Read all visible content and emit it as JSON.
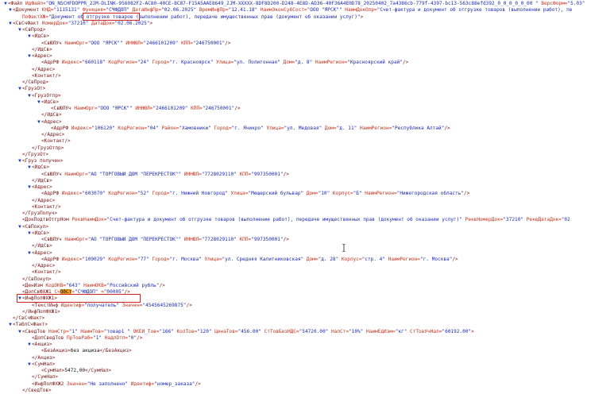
{
  "colors": {
    "tag": "#7a1414",
    "attr_name": "#c8321e",
    "attr_value": "#1e2ab4",
    "text": "#111111",
    "toggle": "#1a3fb5",
    "search_highlight": "#f5a81c",
    "annotation_box": "#d32222"
  },
  "toggles": {
    "expanded": "▼",
    "collapsed": "▶"
  },
  "annotations": {
    "box1_label": "function-attribute-highlight",
    "box2_label": "dopsvfkhzh1-line-highlight"
  },
  "xml_lines": [
    {
      "indent": 0,
      "toggle": "expanded",
      "segments": [
        [
          "tg",
          "<Файл "
        ],
        [
          "an",
          "ИдФайл="
        ],
        [
          "av",
          "\"ON_NSCHFDOPPR_2JM-DLINK-956082F2-AC80-40CE-8C87-F15A5AAE8649_2JM-XXXXX-8DF8D200-D248-4E8D-AD36-40F36A4E0D78_20250402_7a4386cb-779f-4397-bc13-563c88efd392_0_0_0_0_0_00 \" "
        ],
        [
          "an",
          "ВерсФорм="
        ],
        [
          "av",
          "\"5.03\""
        ]
      ]
    },
    {
      "indent": 1,
      "toggle": "expanded",
      "segments": [
        [
          "tg",
          "<Документ "
        ],
        [
          "an",
          "КНД="
        ],
        [
          "av",
          "\"1115131\" "
        ],
        [
          "an",
          "Функция="
        ],
        [
          "av",
          "\"СЧФДОП\" "
        ],
        [
          "an",
          "ДатаИнфПр="
        ],
        [
          "av",
          "\"02.06.2025\" "
        ],
        [
          "an",
          "ВремИнфПр="
        ],
        [
          "av",
          "\"12.41.18\" "
        ],
        [
          "an",
          "НаимЭконСубСост="
        ],
        [
          "av",
          "\"ООО \"ЯРСК\"\" "
        ],
        [
          "an",
          "НаимДокОпр="
        ],
        [
          "av",
          "\"Счет-фактура и документ об отгрузке товаров (выполнении работ), пе"
        ]
      ]
    },
    {
      "indent": 2,
      "toggle": "",
      "segments": [
        [
          "an",
          "ПоФактХЖ="
        ],
        [
          "av",
          "\"Документ об отгрузке товаров (выполнении работ), передаче имущественных прав (документ об оказании услуг)\""
        ],
        [
          "tg",
          ">"
        ]
      ]
    },
    {
      "indent": 1,
      "toggle": "expanded",
      "segments": [
        [
          "tg",
          "<СвСчФакт "
        ],
        [
          "an",
          "НомерДок="
        ],
        [
          "av",
          "\"37210\" "
        ],
        [
          "an",
          "ДатаДок="
        ],
        [
          "av",
          "\"02.06.2025\""
        ],
        [
          "tg",
          ">"
        ]
      ]
    },
    {
      "indent": 2,
      "toggle": "expanded",
      "segments": [
        [
          "tg",
          "<СвПрод>"
        ]
      ]
    },
    {
      "indent": 3,
      "toggle": "expanded",
      "segments": [
        [
          "tg",
          "<ИдСв>"
        ]
      ]
    },
    {
      "indent": 4,
      "toggle": "",
      "segments": [
        [
          "tg",
          "<СвЮЛУч "
        ],
        [
          "an",
          "НаимОрг="
        ],
        [
          "av",
          "\"ООО \"ЯРСК\"\" "
        ],
        [
          "an",
          "ИННЮЛ="
        ],
        [
          "av",
          "\"2466101209\" "
        ],
        [
          "an",
          "КПП="
        ],
        [
          "av",
          "\"246750001\""
        ],
        [
          "tg",
          "/>"
        ]
      ]
    },
    {
      "indent": 3,
      "toggle": "",
      "segments": [
        [
          "tg",
          "</ИдСв>"
        ]
      ]
    },
    {
      "indent": 3,
      "toggle": "expanded",
      "segments": [
        [
          "tg",
          "<Адрес>"
        ]
      ]
    },
    {
      "indent": 4,
      "toggle": "",
      "segments": [
        [
          "tg",
          "<АдрРФ "
        ],
        [
          "an",
          "Индекс="
        ],
        [
          "av",
          "\"660118\" "
        ],
        [
          "an",
          "КодРегион="
        ],
        [
          "av",
          "\"24\" "
        ],
        [
          "an",
          "Город="
        ],
        [
          "av",
          "\"г. Красноярск\" "
        ],
        [
          "an",
          "Улица="
        ],
        [
          "av",
          "\"ул. Полигонная\" "
        ],
        [
          "an",
          "Дом="
        ],
        [
          "av",
          "\"д. 8\" "
        ],
        [
          "an",
          "НаимРегион="
        ],
        [
          "av",
          "\"Красноярский край\""
        ],
        [
          "tg",
          "/>"
        ]
      ]
    },
    {
      "indent": 3,
      "toggle": "",
      "segments": [
        [
          "tg",
          "</Адрес>"
        ]
      ]
    },
    {
      "indent": 3,
      "toggle": "",
      "segments": [
        [
          "tg",
          "<Контакт/>"
        ]
      ]
    },
    {
      "indent": 2,
      "toggle": "",
      "segments": [
        [
          "tg",
          "</СвПрод>"
        ]
      ]
    },
    {
      "indent": 2,
      "toggle": "expanded",
      "segments": [
        [
          "tg",
          "<ГрузОт>"
        ]
      ]
    },
    {
      "indent": 3,
      "toggle": "expanded",
      "segments": [
        [
          "tg",
          "<ГрузОтпр>"
        ]
      ]
    },
    {
      "indent": 4,
      "toggle": "expanded",
      "segments": [
        [
          "tg",
          "<ИдСв>"
        ]
      ]
    },
    {
      "indent": 5,
      "toggle": "",
      "segments": [
        [
          "tg",
          "<СвЮЛУч "
        ],
        [
          "an",
          "НаимОрг="
        ],
        [
          "av",
          "\"ООО \"ЯРСК\"\" "
        ],
        [
          "an",
          "ИННЮЛ="
        ],
        [
          "av",
          "\"2466101209\" "
        ],
        [
          "an",
          "КПП="
        ],
        [
          "av",
          "\"246750001\""
        ],
        [
          "tg",
          "/>"
        ]
      ]
    },
    {
      "indent": 4,
      "toggle": "",
      "segments": [
        [
          "tg",
          "</ИдСв>"
        ]
      ]
    },
    {
      "indent": 4,
      "toggle": "expanded",
      "segments": [
        [
          "tg",
          "<Адрес>"
        ]
      ]
    },
    {
      "indent": 5,
      "toggle": "",
      "segments": [
        [
          "tg",
          "<АдрРФ "
        ],
        [
          "an",
          "Индекс="
        ],
        [
          "av",
          "\"106120\" "
        ],
        [
          "an",
          "КодРегион="
        ],
        [
          "av",
          "\"04\" "
        ],
        [
          "an",
          "Район="
        ],
        [
          "av",
          "\"Хамовники\" "
        ],
        [
          "an",
          "Город="
        ],
        [
          "av",
          "\"г. Ячикро\" "
        ],
        [
          "an",
          "Улица="
        ],
        [
          "av",
          "\"ул. Медовая\" "
        ],
        [
          "an",
          "Дом="
        ],
        [
          "av",
          "\"д. 11\" "
        ],
        [
          "an",
          "НаимРегион="
        ],
        [
          "av",
          "\"Республика Алтай\""
        ],
        [
          "tg",
          "/>"
        ]
      ]
    },
    {
      "indent": 4,
      "toggle": "",
      "segments": [
        [
          "tg",
          "</Адрес>"
        ]
      ]
    },
    {
      "indent": 4,
      "toggle": "",
      "segments": [
        [
          "tg",
          "<Контакт/>"
        ]
      ]
    },
    {
      "indent": 3,
      "toggle": "",
      "segments": [
        [
          "tg",
          "</ГрузОтпр>"
        ]
      ]
    },
    {
      "indent": 2,
      "toggle": "",
      "segments": [
        [
          "tg",
          "</ГрузОт>"
        ]
      ]
    },
    {
      "indent": 2,
      "toggle": "expanded",
      "segments": [
        [
          "tg",
          "<Груз получен>"
        ]
      ]
    },
    {
      "indent": 3,
      "toggle": "expanded",
      "segments": [
        [
          "tg",
          "<ИдСв>"
        ]
      ]
    },
    {
      "indent": 4,
      "toggle": "",
      "segments": [
        [
          "tg",
          "<СвЮЛУч "
        ],
        [
          "an",
          "НаимОрг="
        ],
        [
          "av",
          "\"АО \"ТОРГОВЫЙ ДОМ \"ПЕРЕКРЕСТОК\"\" "
        ],
        [
          "an",
          "ИННЮЛ="
        ],
        [
          "av",
          "\"7728029110\" "
        ],
        [
          "an",
          "КПП="
        ],
        [
          "av",
          "\"997350001\""
        ],
        [
          "tg",
          "/>"
        ]
      ]
    },
    {
      "indent": 3,
      "toggle": "",
      "segments": [
        [
          "tg",
          "</ИдСв>"
        ]
      ]
    },
    {
      "indent": 3,
      "toggle": "expanded",
      "segments": [
        [
          "tg",
          "<Адрес>"
        ]
      ]
    },
    {
      "indent": 4,
      "toggle": "",
      "segments": [
        [
          "tg",
          "<АдрРФ "
        ],
        [
          "an",
          "Индекс="
        ],
        [
          "av",
          "\"603070\" "
        ],
        [
          "an",
          "КодРегион="
        ],
        [
          "av",
          "\"52\" "
        ],
        [
          "an",
          "Город="
        ],
        [
          "av",
          "\"г. Нижний Новгород\" "
        ],
        [
          "an",
          "Улица="
        ],
        [
          "av",
          "\"Мещерский бульвар\" "
        ],
        [
          "an",
          "Дом="
        ],
        [
          "av",
          "\"10\" "
        ],
        [
          "an",
          "Корпус="
        ],
        [
          "av",
          "\"Б\" "
        ],
        [
          "an",
          "НаимРегион="
        ],
        [
          "av",
          "\"Нижегородская область\""
        ],
        [
          "tg",
          "/>"
        ]
      ]
    },
    {
      "indent": 3,
      "toggle": "",
      "segments": [
        [
          "tg",
          "</Адрес>"
        ]
      ]
    },
    {
      "indent": 3,
      "toggle": "",
      "segments": [
        [
          "tg",
          "<Контакт/>"
        ]
      ]
    },
    {
      "indent": 2,
      "toggle": "",
      "segments": [
        [
          "tg",
          "</ГрузПолуч>"
        ]
      ]
    },
    {
      "indent": 2,
      "toggle": "",
      "segments": [
        [
          "tg",
          "<ДокПодтвОтгрНом "
        ],
        [
          "an",
          "РеквНаимДок="
        ],
        [
          "av",
          "\"Счет-фактура и документ об отгрузке товаров (выполнении работ), передаче имущественных прав (документ об оказании услуг)\" "
        ],
        [
          "an",
          "РеквНомерДок="
        ],
        [
          "av",
          "\"37210\" "
        ],
        [
          "an",
          "РеквДатаДок="
        ],
        [
          "av",
          "\"02"
        ]
      ]
    },
    {
      "indent": 2,
      "toggle": "expanded",
      "segments": [
        [
          "tg",
          "<СвПокуп>"
        ]
      ]
    },
    {
      "indent": 3,
      "toggle": "expanded",
      "segments": [
        [
          "tg",
          "<ИдСв>"
        ]
      ]
    },
    {
      "indent": 4,
      "toggle": "",
      "segments": [
        [
          "tg",
          "<СвЮЛУч "
        ],
        [
          "an",
          "НаимОрг="
        ],
        [
          "av",
          "\"АО \"ТОРГОВЫЙ ДОМ \"ПЕРЕКРЕСТОК\"\" "
        ],
        [
          "an",
          "ИННЮЛ="
        ],
        [
          "av",
          "\"7728029110\" "
        ],
        [
          "an",
          "КПП="
        ],
        [
          "av",
          "\"997350001\""
        ],
        [
          "tg",
          "/>"
        ]
      ]
    },
    {
      "indent": 3,
      "toggle": "",
      "segments": [
        [
          "tg",
          "</ИдСв>"
        ]
      ]
    },
    {
      "indent": 3,
      "toggle": "expanded",
      "segments": [
        [
          "tg",
          "<Адрес>"
        ]
      ]
    },
    {
      "indent": 4,
      "toggle": "",
      "segments": [
        [
          "tg",
          "<АдрРФ "
        ],
        [
          "an",
          "Индекс="
        ],
        [
          "av",
          "\"109029\" "
        ],
        [
          "an",
          "КодРегион="
        ],
        [
          "av",
          "\"77\" "
        ],
        [
          "an",
          "Город="
        ],
        [
          "av",
          "\"г. Москва\" "
        ],
        [
          "an",
          "Улица="
        ],
        [
          "av",
          "\"ул. Средняя Калитниковская\" "
        ],
        [
          "an",
          "Дом="
        ],
        [
          "av",
          "\"д. 28\" "
        ],
        [
          "an",
          "Корпус="
        ],
        [
          "av",
          "\"стр. 4\" "
        ],
        [
          "an",
          "НаимРегион="
        ],
        [
          "av",
          "\"г. Москва\""
        ],
        [
          "tg",
          "/>"
        ]
      ]
    },
    {
      "indent": 3,
      "toggle": "",
      "segments": [
        [
          "tg",
          "</Адрес>"
        ]
      ]
    },
    {
      "indent": 3,
      "toggle": "",
      "segments": [
        [
          "tg",
          "<Контакт/>"
        ]
      ]
    },
    {
      "indent": 2,
      "toggle": "",
      "segments": [
        [
          "tg",
          "</СвПокуп>"
        ]
      ]
    },
    {
      "indent": 2,
      "toggle": "",
      "segments": [
        [
          "tg",
          "<ДенИзм "
        ],
        [
          "an",
          "КодОКВ="
        ],
        [
          "av",
          "\"643\" "
        ],
        [
          "an",
          "НаимОКВ="
        ],
        [
          "av",
          "\"Российский рубль\""
        ],
        [
          "tg",
          "/>"
        ]
      ]
    },
    {
      "indent": 2,
      "toggle": "",
      "segments": [
        [
          "tg",
          "<ДопСвФХЖ1 "
        ],
        [
          "an",
          "Сч"
        ],
        [
          "hl",
          "ОбСт"
        ],
        [
          "an",
          "="
        ],
        [
          "av",
          "\"СЧФДОП\" "
        ],
        [
          "an",
          "="
        ],
        [
          "av",
          "\"00005\""
        ],
        [
          "tg",
          "/>"
        ]
      ]
    },
    {
      "indent": 2,
      "toggle": "expanded",
      "segments": [
        [
          "tg",
          "<ИнфПолФХЖ1>"
        ]
      ]
    },
    {
      "indent": 3,
      "toggle": "",
      "segments": [
        [
          "tg",
          "<ТекстИнф "
        ],
        [
          "an",
          "Идентиф="
        ],
        [
          "av",
          "\"получатель\" "
        ],
        [
          "an",
          "Значен="
        ],
        [
          "av",
          "\"4545645269875\""
        ],
        [
          "tg",
          "/>"
        ]
      ]
    },
    {
      "indent": 2,
      "toggle": "",
      "segments": [
        [
          "tg",
          "</ИнфПолФХЖ1>"
        ]
      ]
    },
    {
      "indent": 1,
      "toggle": "",
      "segments": [
        [
          "tg",
          "</СвСчФакт>"
        ]
      ]
    },
    {
      "indent": 1,
      "toggle": "expanded",
      "segments": [
        [
          "tg",
          "<ТаблСчФакт>"
        ]
      ]
    },
    {
      "indent": 2,
      "toggle": "expanded",
      "segments": [
        [
          "tg",
          "<СведТов "
        ],
        [
          "an",
          "НомСтр="
        ],
        [
          "av",
          "\"1\" "
        ],
        [
          "an",
          "НаимТов="
        ],
        [
          "av",
          "\"товар1 \" "
        ],
        [
          "an",
          "ОКЕИ_Тов="
        ],
        [
          "av",
          "\"166\" "
        ],
        [
          "an",
          "КолТов="
        ],
        [
          "av",
          "\"120\" "
        ],
        [
          "an",
          "ЦенаТов="
        ],
        [
          "av",
          "\"456.00\" "
        ],
        [
          "an",
          "СтТовБезНДС="
        ],
        [
          "av",
          "\"54720.00\" "
        ],
        [
          "an",
          "НалСт="
        ],
        [
          "av",
          "\"10%\" "
        ],
        [
          "an",
          "НаимЕдИзм="
        ],
        [
          "av",
          "\"кг\" "
        ],
        [
          "an",
          "СтТовУчНал="
        ],
        [
          "av",
          "\"60192.00\""
        ],
        [
          "tg",
          ">"
        ]
      ]
    },
    {
      "indent": 3,
      "toggle": "",
      "segments": [
        [
          "tg",
          "<ДопСведТов "
        ],
        [
          "an",
          "ПрТовРаб="
        ],
        [
          "av",
          "\"1\" "
        ],
        [
          "an",
          "НадлОтп="
        ],
        [
          "av",
          "\"0\""
        ],
        [
          "tg",
          "/>"
        ]
      ]
    },
    {
      "indent": 3,
      "toggle": "expanded",
      "segments": [
        [
          "tg",
          "<Акциз>"
        ]
      ]
    },
    {
      "indent": 4,
      "toggle": "",
      "segments": [
        [
          "tg",
          "<БезАкциз>"
        ],
        [
          "tx",
          "без акциза"
        ],
        [
          "tg",
          "</БезАкциз>"
        ]
      ]
    },
    {
      "indent": 3,
      "toggle": "",
      "segments": [
        [
          "tg",
          "</Акциз>"
        ]
      ]
    },
    {
      "indent": 3,
      "toggle": "expanded",
      "segments": [
        [
          "tg",
          "<СумНал>"
        ]
      ]
    },
    {
      "indent": 4,
      "toggle": "",
      "segments": [
        [
          "tg",
          "<СумНал>"
        ],
        [
          "tx",
          "5472,00"
        ],
        [
          "tg",
          "</СумНал>"
        ]
      ]
    },
    {
      "indent": 3,
      "toggle": "",
      "segments": [
        [
          "tg",
          "</СумНал>"
        ]
      ]
    },
    {
      "indent": 3,
      "toggle": "",
      "segments": [
        [
          "tg",
          "<ИнфПолФХЖ2 "
        ],
        [
          "an",
          "Значен="
        ],
        [
          "av",
          "\"Не заполнено\" "
        ],
        [
          "an",
          "Идентиф="
        ],
        [
          "av",
          "\"номер_заказа\""
        ],
        [
          "tg",
          "/>"
        ]
      ]
    },
    {
      "indent": 2,
      "toggle": "",
      "segments": [
        [
          "tg",
          "</СведТов>"
        ]
      ]
    }
  ]
}
